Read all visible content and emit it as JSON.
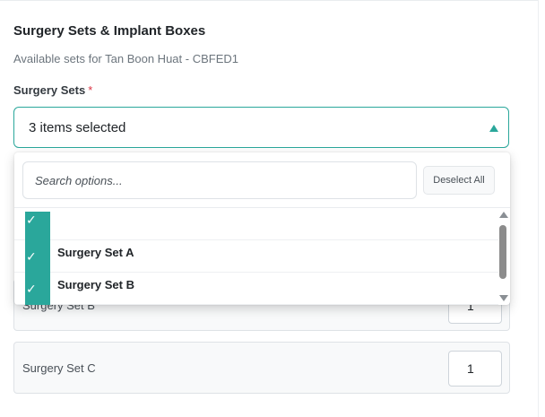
{
  "section": {
    "title": "Surgery Sets & Implant Boxes",
    "subtitle": "Available sets for Tan Boon Huat - CBFED1"
  },
  "field": {
    "label": "Surgery Sets",
    "required_mark": "*",
    "selected_summary": "3 items selected"
  },
  "dropdown": {
    "search_placeholder": "Search options...",
    "deselect_label": "Deselect All",
    "options": [
      {
        "label": "",
        "checked": true
      },
      {
        "label": "Surgery Set A",
        "checked": true
      },
      {
        "label": "Surgery Set B",
        "checked": true
      }
    ],
    "check_glyph": "✓"
  },
  "rows": [
    {
      "label": "Surgery Set B",
      "quantity": "1"
    },
    {
      "label": "Surgery Set C",
      "quantity": "1"
    }
  ],
  "colors": {
    "accent": "#2aa79b",
    "required": "#dc3545"
  }
}
